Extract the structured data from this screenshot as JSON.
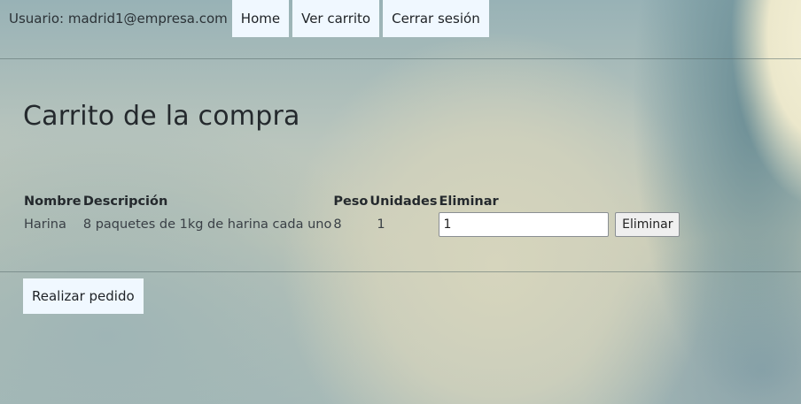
{
  "header": {
    "user_label": "Usuario: madrid1@empresa.com",
    "nav": [
      {
        "label": "Home"
      },
      {
        "label": "Ver carrito"
      },
      {
        "label": "Cerrar sesión"
      }
    ]
  },
  "main": {
    "title": "Carrito de la compra",
    "table": {
      "columns": [
        "Nombre",
        "Descripción",
        "Peso",
        "Unidades",
        "Eliminar"
      ],
      "rows": [
        {
          "nombre": "Harina",
          "descripcion": "8 paquetes de 1kg de harina cada uno",
          "peso": "8",
          "unidades": "1",
          "eliminar_input_value": "1",
          "eliminar_button_label": "Eliminar"
        }
      ]
    },
    "order_button_label": "Realizar pedido"
  }
}
